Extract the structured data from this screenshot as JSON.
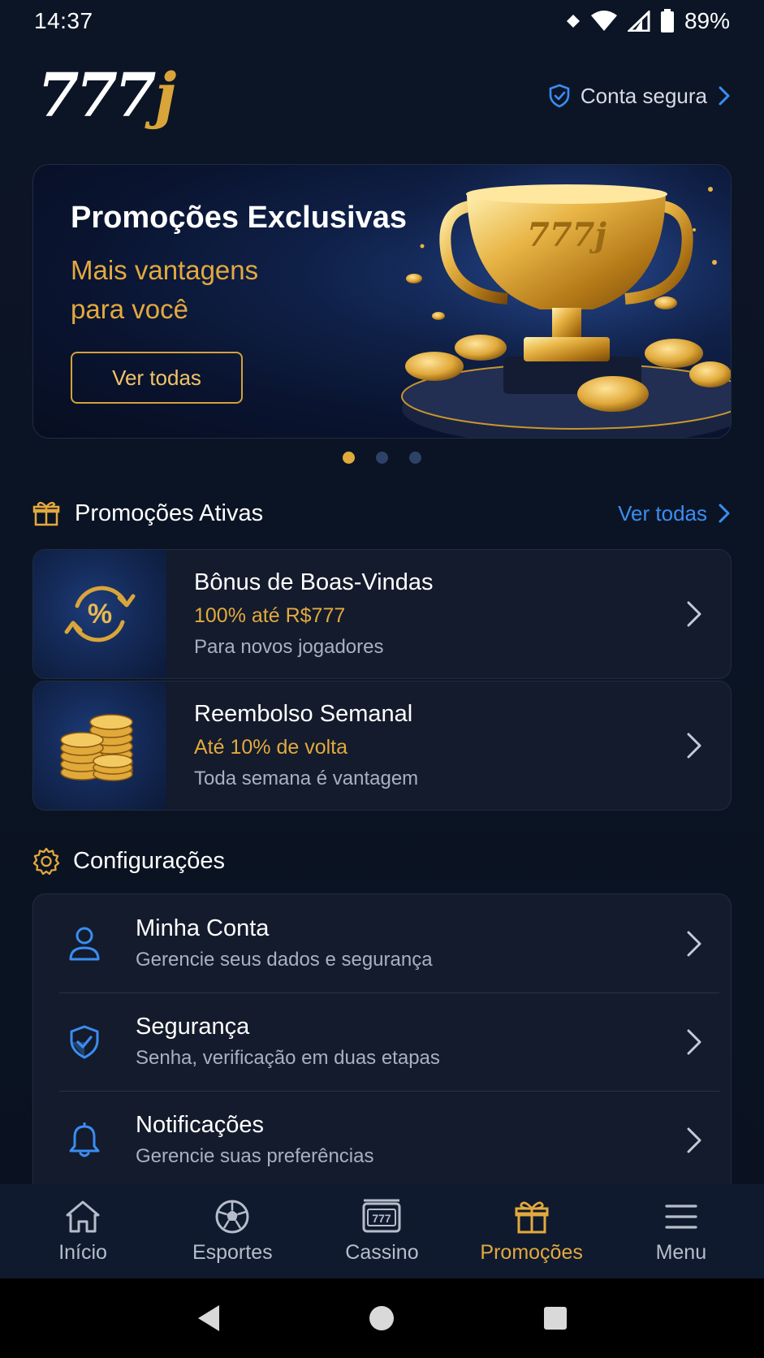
{
  "status_bar": {
    "time": "14:37",
    "battery": "89%"
  },
  "header": {
    "logo_number": "777",
    "logo_letter": "j",
    "secure_label": "Conta segura"
  },
  "banner": {
    "title": "Promoções Exclusivas",
    "subtitle": "Mais vantagens para você",
    "button_label": "Ver todas",
    "trophy_engraving": "777j",
    "carousel_active_index": 0,
    "carousel_count": 3
  },
  "active_promos": {
    "title": "Promoções Ativas",
    "see_all": "Ver todas",
    "items": [
      {
        "title": "Bônus de Boas-Vindas",
        "highlight": "100% até R$777",
        "description": "Para novos jogadores",
        "icon": "percent-cycle-icon"
      },
      {
        "title": "Reembolso Semanal",
        "highlight": "Até 10% de volta",
        "description": "Toda semana é vantagem",
        "icon": "gold-coins-icon"
      }
    ]
  },
  "settings": {
    "title": "Configurações",
    "items": [
      {
        "title": "Minha Conta",
        "description": "Gerencie seus dados e segurança",
        "icon": "user-icon"
      },
      {
        "title": "Segurança",
        "description": "Senha, verificação em duas etapas",
        "icon": "shield-check-icon"
      },
      {
        "title": "Notificações",
        "description": "Gerencie suas preferências",
        "icon": "bell-icon"
      }
    ]
  },
  "bottom_nav": {
    "items": [
      {
        "label": "Início",
        "icon": "home-icon"
      },
      {
        "label": "Esportes",
        "icon": "soccer-ball-icon"
      },
      {
        "label": "Cassino",
        "icon": "slot-machine-icon",
        "icon_text": "777"
      },
      {
        "label": "Promoções",
        "icon": "gift-icon",
        "active": true
      },
      {
        "label": "Menu",
        "icon": "hamburger-menu-icon"
      }
    ]
  },
  "colors": {
    "accent_gold": "#e3a93e",
    "link_blue": "#3b8df2",
    "background": "#0b1322",
    "card": "#131b2c"
  }
}
